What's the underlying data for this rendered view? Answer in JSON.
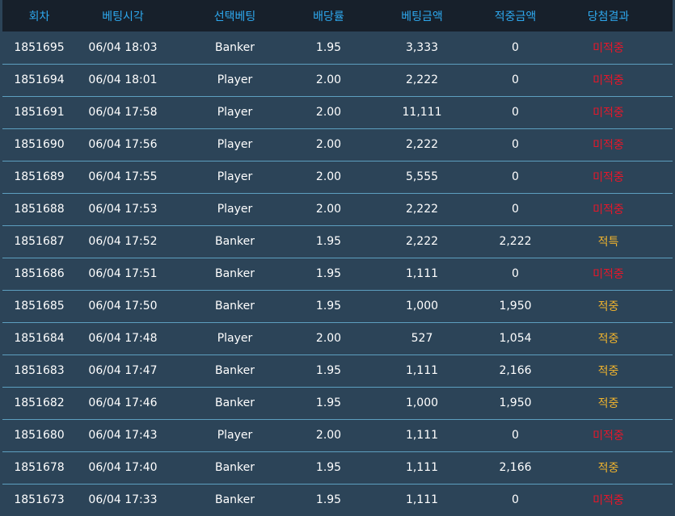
{
  "table": {
    "headers": [
      "회차",
      "베팅시각",
      "선택베팅",
      "배당률",
      "베팅금액",
      "적중금액",
      "당첨결과"
    ],
    "rows": [
      {
        "round": "1851695",
        "time": "06/04 18:03",
        "pick": "Banker",
        "odds": "1.95",
        "bet": "3,333",
        "win": "0",
        "result": "미적중",
        "status": "miss"
      },
      {
        "round": "1851694",
        "time": "06/04 18:01",
        "pick": "Player",
        "odds": "2.00",
        "bet": "2,222",
        "win": "0",
        "result": "미적중",
        "status": "miss"
      },
      {
        "round": "1851691",
        "time": "06/04 17:58",
        "pick": "Player",
        "odds": "2.00",
        "bet": "11,111",
        "win": "0",
        "result": "미적중",
        "status": "miss"
      },
      {
        "round": "1851690",
        "time": "06/04 17:56",
        "pick": "Player",
        "odds": "2.00",
        "bet": "2,222",
        "win": "0",
        "result": "미적중",
        "status": "miss"
      },
      {
        "round": "1851689",
        "time": "06/04 17:55",
        "pick": "Player",
        "odds": "2.00",
        "bet": "5,555",
        "win": "0",
        "result": "미적중",
        "status": "miss"
      },
      {
        "round": "1851688",
        "time": "06/04 17:53",
        "pick": "Player",
        "odds": "2.00",
        "bet": "2,222",
        "win": "0",
        "result": "미적중",
        "status": "miss"
      },
      {
        "round": "1851687",
        "time": "06/04 17:52",
        "pick": "Banker",
        "odds": "1.95",
        "bet": "2,222",
        "win": "2,222",
        "result": "적특",
        "status": "hit"
      },
      {
        "round": "1851686",
        "time": "06/04 17:51",
        "pick": "Banker",
        "odds": "1.95",
        "bet": "1,111",
        "win": "0",
        "result": "미적중",
        "status": "miss"
      },
      {
        "round": "1851685",
        "time": "06/04 17:50",
        "pick": "Banker",
        "odds": "1.95",
        "bet": "1,000",
        "win": "1,950",
        "result": "적중",
        "status": "hit"
      },
      {
        "round": "1851684",
        "time": "06/04 17:48",
        "pick": "Player",
        "odds": "2.00",
        "bet": "527",
        "win": "1,054",
        "result": "적중",
        "status": "hit"
      },
      {
        "round": "1851683",
        "time": "06/04 17:47",
        "pick": "Banker",
        "odds": "1.95",
        "bet": "1,111",
        "win": "2,166",
        "result": "적중",
        "status": "hit"
      },
      {
        "round": "1851682",
        "time": "06/04 17:46",
        "pick": "Banker",
        "odds": "1.95",
        "bet": "1,000",
        "win": "1,950",
        "result": "적중",
        "status": "hit"
      },
      {
        "round": "1851680",
        "time": "06/04 17:43",
        "pick": "Player",
        "odds": "2.00",
        "bet": "1,111",
        "win": "0",
        "result": "미적중",
        "status": "miss"
      },
      {
        "round": "1851678",
        "time": "06/04 17:40",
        "pick": "Banker",
        "odds": "1.95",
        "bet": "1,111",
        "win": "2,166",
        "result": "적중",
        "status": "hit"
      },
      {
        "round": "1851673",
        "time": "06/04 17:33",
        "pick": "Banker",
        "odds": "1.95",
        "bet": "1,111",
        "win": "0",
        "result": "미적중",
        "status": "miss"
      }
    ]
  },
  "colors": {
    "header_bg": "#17202b",
    "header_text": "#2ea8ee",
    "row_bg": "#2c4458",
    "row_border": "#5d9fbf",
    "text": "#ffffff",
    "miss": "#e6172a",
    "hit": "#f0b32d"
  }
}
